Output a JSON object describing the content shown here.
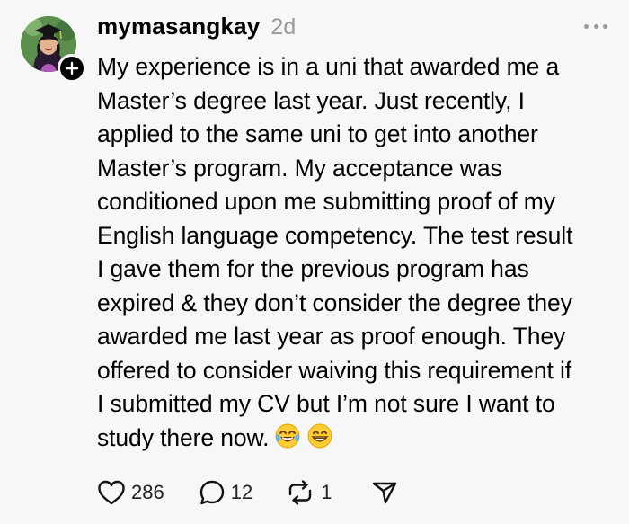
{
  "post": {
    "username": "mymasangkay",
    "timestamp": "2d",
    "lines": [
      "My experience is in a uni that awarded me a",
      "Master’s degree last year. Just recently, I",
      "applied to the same uni to get into another",
      "Master’s program. My acceptance was",
      "conditioned upon me submitting proof of my",
      "English language competency. The test result",
      "I gave them for the previous program has",
      "expired & they don’t consider the degree they",
      "awarded me last year as proof enough. They",
      "offered to consider waiving this requirement if",
      "I submitted my CV but I’m not sure I want to",
      "study there now."
    ],
    "emojis": [
      "face-with-tears-of-joy-icon",
      "grinning-face-icon"
    ]
  },
  "actions": {
    "like_count": "286",
    "reply_count": "12",
    "repost_count": "1"
  },
  "icons": {
    "like": "heart-icon",
    "reply": "speech-bubble-icon",
    "repost": "repost-icon",
    "share": "send-icon",
    "more": "more-dots-icon",
    "follow": "plus-icon"
  },
  "colors": {
    "background": "#f7f7f7",
    "text": "#000000",
    "muted": "#9a9a9a"
  }
}
